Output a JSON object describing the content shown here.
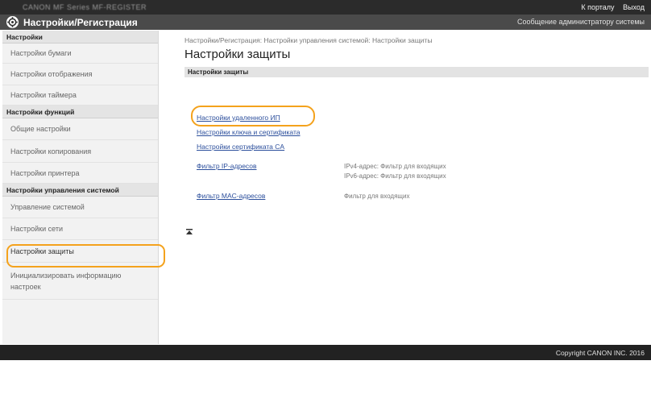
{
  "topbar": {
    "product": "CANON MF Series MF-REGISTER",
    "back_label": "К порталу",
    "logout_label": "Выход"
  },
  "header": {
    "title": "Настройки/Регистрация",
    "admin_link": "Сообщение администратору системы"
  },
  "sidebar": {
    "sections": [
      {
        "title": "Настройки",
        "items": [
          "Настройки бумаги",
          "Настройки отображения",
          "Настройки таймера"
        ]
      },
      {
        "title": "Настройки функций",
        "items": [
          "Общие настройки",
          "Настройки копирования",
          "Настройки принтера"
        ]
      },
      {
        "title": "Настройки управления системой",
        "items": [
          "Управление системой",
          "Настройки сети",
          "Настройки защиты",
          "Инициализировать информацию настроек"
        ]
      }
    ]
  },
  "main": {
    "breadcrumb": "Настройки/Регистрация: Настройки управления системой: Настройки защиты",
    "title": "Настройки защиты",
    "section_header": "Настройки защиты",
    "links": [
      {
        "label": "Настройки удаленного ИП",
        "desc": ""
      },
      {
        "label": "Настройки ключа и сертификата",
        "desc": ""
      },
      {
        "label": "Настройки сертификата CA",
        "desc": ""
      },
      {
        "label": "Фильтр IP-адресов",
        "desc": "IPv4-адрес: Фильтр для входящих",
        "desc2": "IPv6-адрес: Фильтр для входящих"
      },
      {
        "label": "Фильтр MAC-адресов",
        "desc": "Фильтр для входящих"
      }
    ],
    "top_icon": "to-top-icon"
  },
  "footer": {
    "copyright": "Copyright CANON INC. 2016"
  },
  "colors": {
    "highlight": "#f4a21c",
    "link": "#2c4f9c",
    "header_bg": "#4a4a4a",
    "topbar_bg": "#2b2b2b"
  }
}
